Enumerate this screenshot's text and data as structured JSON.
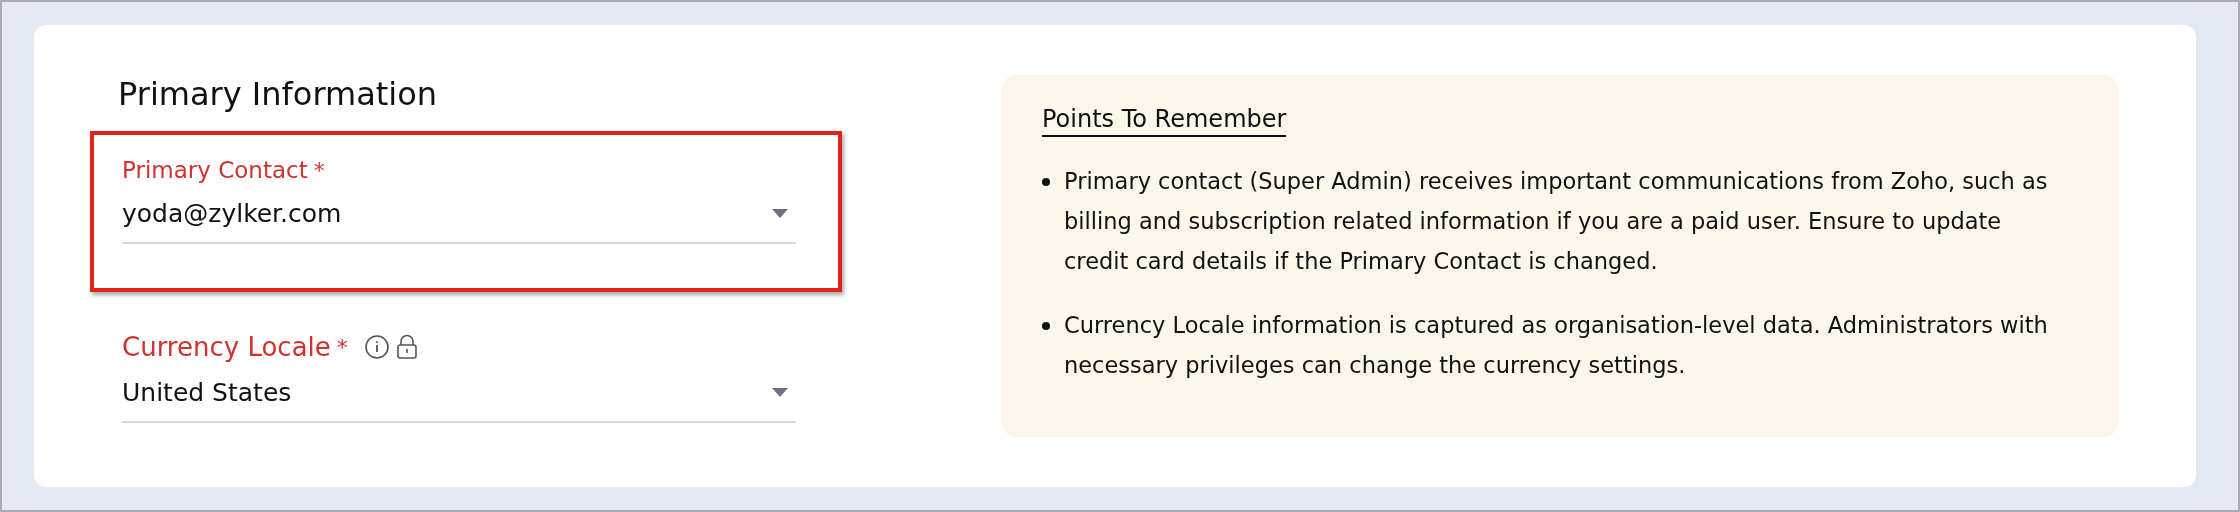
{
  "section": {
    "title": "Primary Information"
  },
  "fields": [
    {
      "label": "Primary Contact",
      "required_mark": "*",
      "value": "yoda@zylker.com",
      "highlighted": true,
      "locked": false
    },
    {
      "label": "Currency Locale",
      "required_mark": "*",
      "value": "United States",
      "highlighted": false,
      "locked": true
    }
  ],
  "notes": {
    "title": "Points To Remember",
    "items": [
      "Primary contact (Super Admin) receives important communications from Zoho, such as billing and subscription related information if you are a paid user. Ensure to update credit card details if the Primary Contact is changed.",
      "Currency Locale information is captured as organisation-level data. Administrators with necessary privileges can change the currency settings."
    ]
  }
}
